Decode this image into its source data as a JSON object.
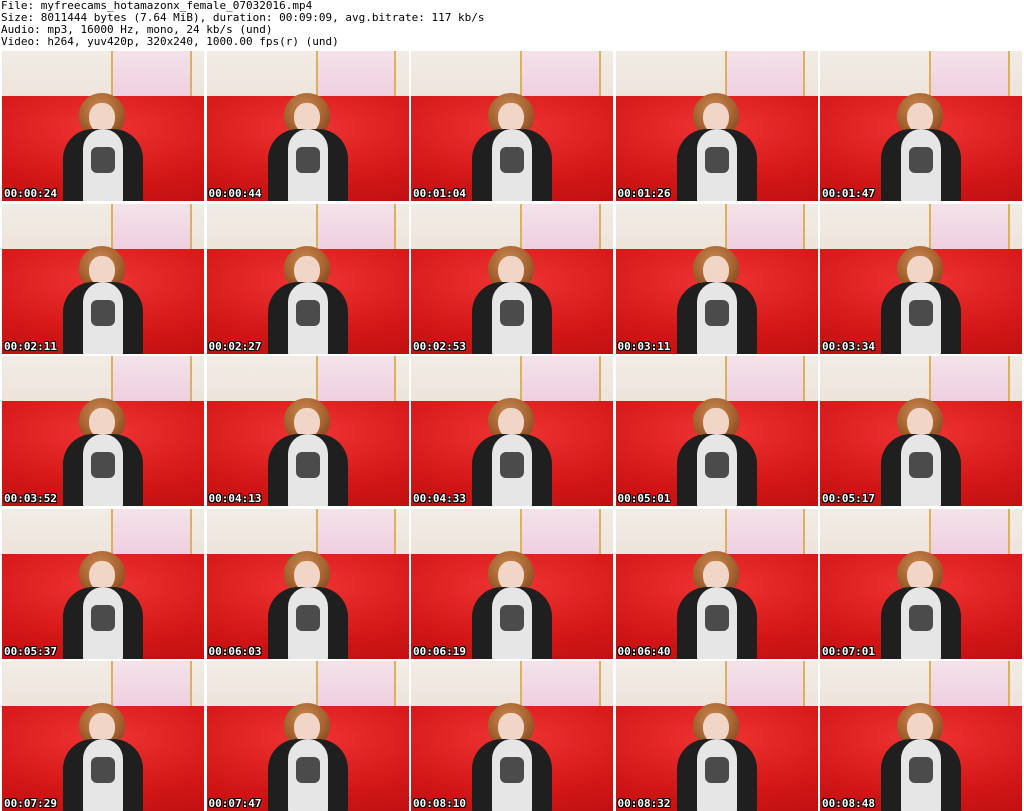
{
  "header": {
    "file": "File: myfreecams_hotamazonx_female_07032016.mp4",
    "size": "Size: 8011444 bytes (7.64 MiB), duration: 00:09:09, avg.bitrate: 117 kb/s",
    "audio": "Audio: mp3, 16000 Hz, mono, 24 kb/s (und)",
    "video": "Video: h264, yuv420p, 320x240, 1000.00 fps(r) (und)"
  },
  "thumbnails": [
    {
      "timestamp": "00:00:24"
    },
    {
      "timestamp": "00:00:44"
    },
    {
      "timestamp": "00:01:04"
    },
    {
      "timestamp": "00:01:26"
    },
    {
      "timestamp": "00:01:47"
    },
    {
      "timestamp": "00:02:11"
    },
    {
      "timestamp": "00:02:27"
    },
    {
      "timestamp": "00:02:53"
    },
    {
      "timestamp": "00:03:11"
    },
    {
      "timestamp": "00:03:34"
    },
    {
      "timestamp": "00:03:52"
    },
    {
      "timestamp": "00:04:13"
    },
    {
      "timestamp": "00:04:33"
    },
    {
      "timestamp": "00:05:01"
    },
    {
      "timestamp": "00:05:17"
    },
    {
      "timestamp": "00:05:37"
    },
    {
      "timestamp": "00:06:03"
    },
    {
      "timestamp": "00:06:19"
    },
    {
      "timestamp": "00:06:40"
    },
    {
      "timestamp": "00:07:01"
    },
    {
      "timestamp": "00:07:29"
    },
    {
      "timestamp": "00:07:47"
    },
    {
      "timestamp": "00:08:10"
    },
    {
      "timestamp": "00:08:32"
    },
    {
      "timestamp": "00:08:48"
    }
  ]
}
